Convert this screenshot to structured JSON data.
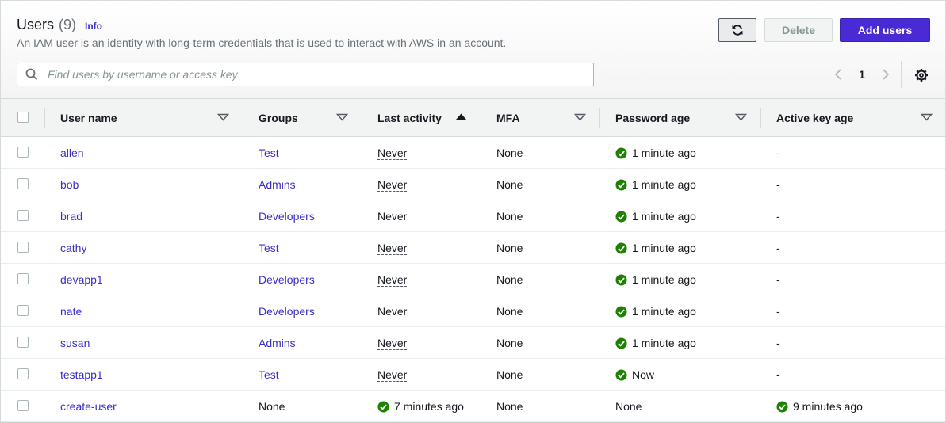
{
  "header": {
    "title": "Users",
    "count": "(9)",
    "info_label": "Info",
    "description": "An IAM user is an identity with long-term credentials that is used to interact with AWS in an account."
  },
  "actions": {
    "refresh_icon": "refresh-icon",
    "delete_label": "Delete",
    "add_label": "Add users"
  },
  "search": {
    "placeholder": "Find users by username or access key",
    "value": ""
  },
  "pagination": {
    "current_page": "1"
  },
  "colors": {
    "primary": "#4a2ad4",
    "link": "#3b2fc9",
    "success": "#1d8102",
    "header_bg": "#f2f3f3"
  },
  "columns": {
    "user_name": "User name",
    "groups": "Groups",
    "last_activity": "Last activity",
    "mfa": "MFA",
    "password_age": "Password age",
    "active_key_age": "Active key age"
  },
  "rows": [
    {
      "user_name": "allen",
      "groups": "Test",
      "last_activity": "Never",
      "mfa": "None",
      "password_age": "1 minute ago",
      "active_key_age": "-"
    },
    {
      "user_name": "bob",
      "groups": "Admins",
      "last_activity": "Never",
      "mfa": "None",
      "password_age": "1 minute ago",
      "active_key_age": "-"
    },
    {
      "user_name": "brad",
      "groups": "Developers",
      "last_activity": "Never",
      "mfa": "None",
      "password_age": "1 minute ago",
      "active_key_age": "-"
    },
    {
      "user_name": "cathy",
      "groups": "Test",
      "last_activity": "Never",
      "mfa": "None",
      "password_age": "1 minute ago",
      "active_key_age": "-"
    },
    {
      "user_name": "devapp1",
      "groups": "Developers",
      "last_activity": "Never",
      "mfa": "None",
      "password_age": "1 minute ago",
      "active_key_age": "-"
    },
    {
      "user_name": "nate",
      "groups": "Developers",
      "last_activity": "Never",
      "mfa": "None",
      "password_age": "1 minute ago",
      "active_key_age": "-"
    },
    {
      "user_name": "susan",
      "groups": "Admins",
      "last_activity": "Never",
      "mfa": "None",
      "password_age": "1 minute ago",
      "active_key_age": "-"
    },
    {
      "user_name": "testapp1",
      "groups": "Test",
      "last_activity": "Never",
      "mfa": "None",
      "password_age": "Now",
      "active_key_age": "-"
    },
    {
      "user_name": "create-user",
      "groups": "None",
      "last_activity": "7 minutes ago",
      "mfa": "None",
      "password_age": "None",
      "active_key_age": "9 minutes ago"
    }
  ]
}
